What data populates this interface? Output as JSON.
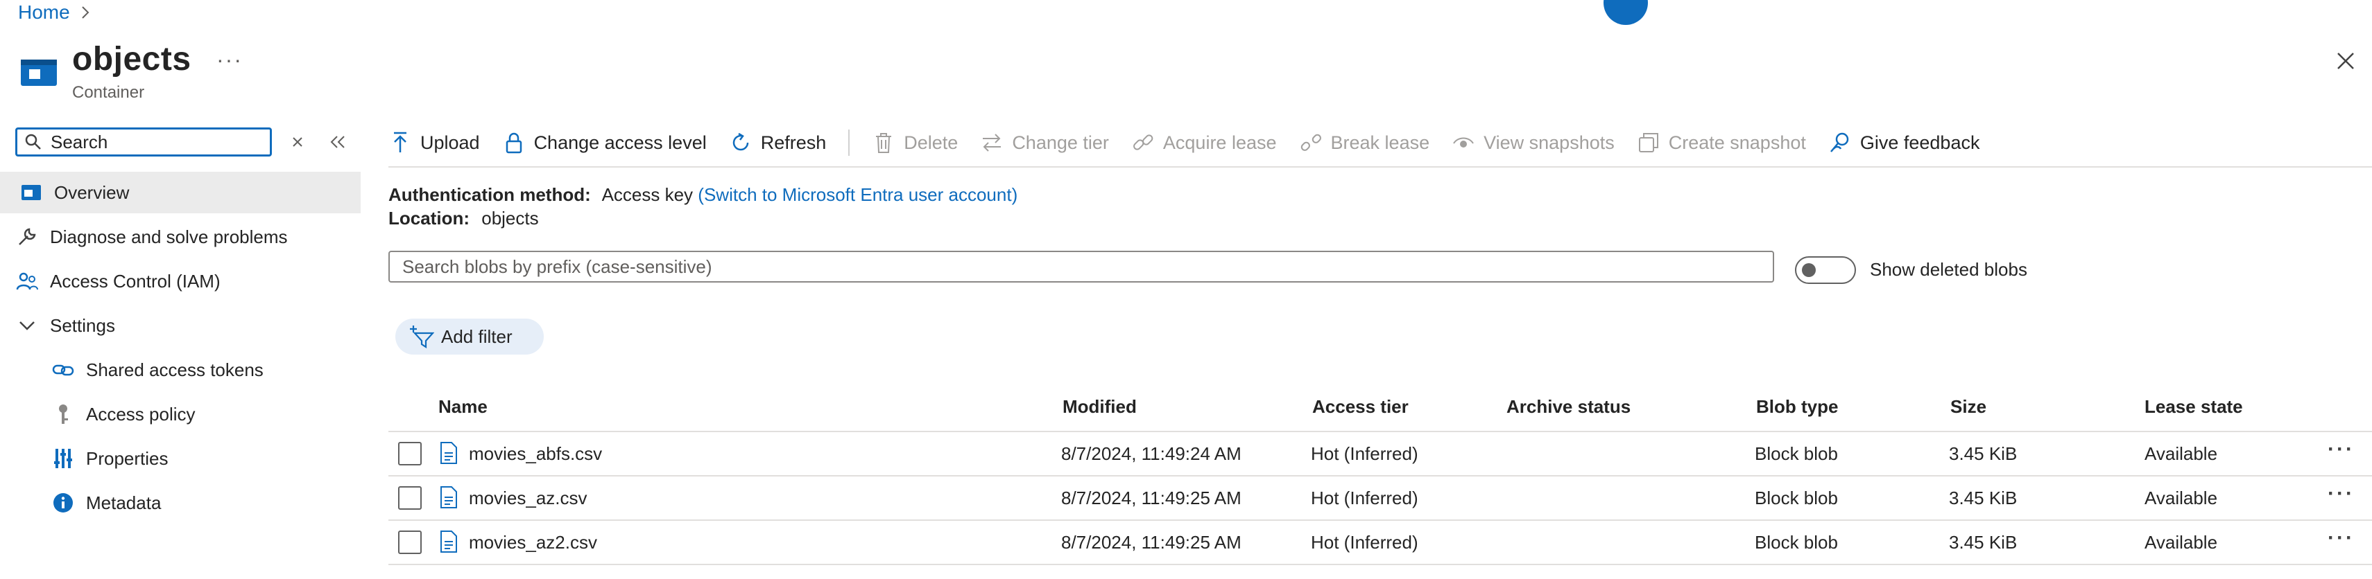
{
  "breadcrumb": {
    "home": "Home"
  },
  "header": {
    "title": "objects",
    "subtitle": "Container"
  },
  "nav": {
    "search_placeholder": "Search",
    "items": {
      "overview": "Overview",
      "diagnose": "Diagnose and solve problems",
      "iam": "Access Control (IAM)",
      "settings": "Settings",
      "sat": "Shared access tokens",
      "policy": "Access policy",
      "props": "Properties",
      "meta": "Metadata"
    }
  },
  "toolbar": {
    "upload": "Upload",
    "change_access": "Change access level",
    "refresh": "Refresh",
    "delete": "Delete",
    "change_tier": "Change tier",
    "acquire_lease": "Acquire lease",
    "break_lease": "Break lease",
    "view_snapshots": "View snapshots",
    "create_snapshot": "Create snapshot",
    "feedback": "Give feedback"
  },
  "info": {
    "auth_label": "Authentication method:",
    "auth_value": "Access key",
    "auth_link": "(Switch to Microsoft Entra user account)",
    "loc_label": "Location:",
    "loc_value": "objects"
  },
  "blob_search": {
    "placeholder": "Search blobs by prefix (case-sensitive)"
  },
  "show_deleted": "Show deleted blobs",
  "add_filter": "Add filter",
  "table": {
    "headers": {
      "name": "Name",
      "modified": "Modified",
      "tier": "Access tier",
      "archive": "Archive status",
      "type": "Blob type",
      "size": "Size",
      "lease": "Lease state"
    },
    "rows": [
      {
        "name": "movies_abfs.csv",
        "modified": "8/7/2024, 11:49:24 AM",
        "tier": "Hot (Inferred)",
        "archive": "",
        "type": "Block blob",
        "size": "3.45 KiB",
        "lease": "Available"
      },
      {
        "name": "movies_az.csv",
        "modified": "8/7/2024, 11:49:25 AM",
        "tier": "Hot (Inferred)",
        "archive": "",
        "type": "Block blob",
        "size": "3.45 KiB",
        "lease": "Available"
      },
      {
        "name": "movies_az2.csv",
        "modified": "8/7/2024, 11:49:25 AM",
        "tier": "Hot (Inferred)",
        "archive": "",
        "type": "Block blob",
        "size": "3.45 KiB",
        "lease": "Available"
      }
    ]
  },
  "colors": {
    "accent": "#0f6cbd",
    "selected_bg": "#ebebeb",
    "disabled": "#a19f9d"
  }
}
